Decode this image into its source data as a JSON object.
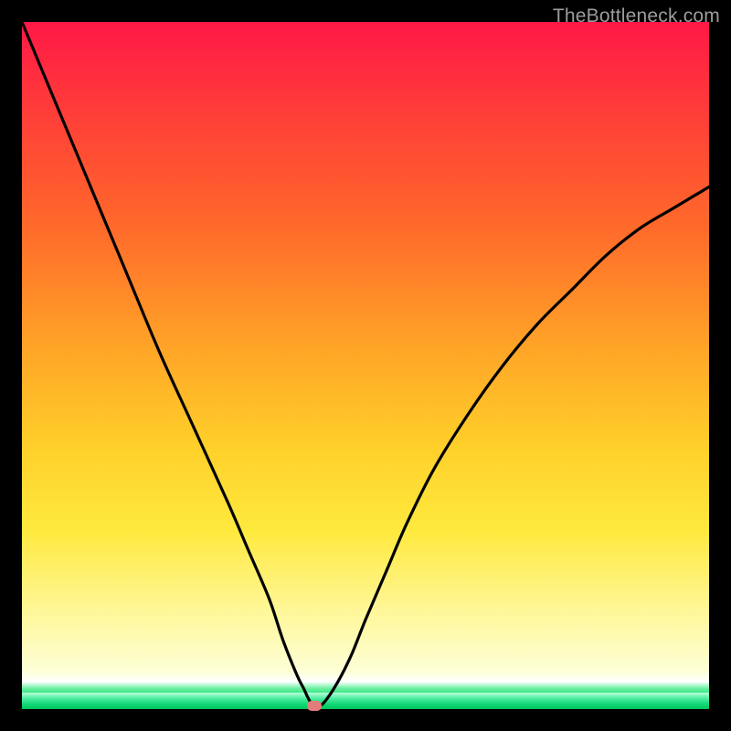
{
  "watermark": "TheBottleneck.com",
  "colors": {
    "gradient_top": "#ff1846",
    "gradient_mid1": "#ffa627",
    "gradient_mid2": "#ffe93e",
    "gradient_bottom_pale": "#fdffd6",
    "green": "#00c558",
    "curve": "#000000",
    "marker": "#e47c7c",
    "frame": "#000000",
    "watermark_text": "#9c9c9c"
  },
  "chart_data": {
    "type": "line",
    "title": "",
    "xlabel": "",
    "ylabel": "",
    "xlim": [
      0,
      100
    ],
    "ylim": [
      0,
      100
    ],
    "series": [
      {
        "name": "bottleneck-curve",
        "x": [
          0,
          5,
          10,
          15,
          20,
          25,
          30,
          33,
          36,
          38,
          40,
          41,
          42,
          43,
          44,
          46,
          48,
          50,
          53,
          56,
          60,
          65,
          70,
          75,
          80,
          85,
          90,
          95,
          100
        ],
        "y": [
          100,
          88,
          76,
          64,
          52,
          41,
          30,
          23,
          16,
          10,
          5,
          3,
          1,
          0.5,
          1,
          4,
          8,
          13,
          20,
          27,
          35,
          43,
          50,
          56,
          61,
          66,
          70,
          73,
          76
        ]
      }
    ],
    "annotations": [
      {
        "name": "optimal-marker",
        "x": 42.6,
        "y": 0,
        "shape": "rounded-rect",
        "color": "#e47c7c"
      }
    ]
  }
}
